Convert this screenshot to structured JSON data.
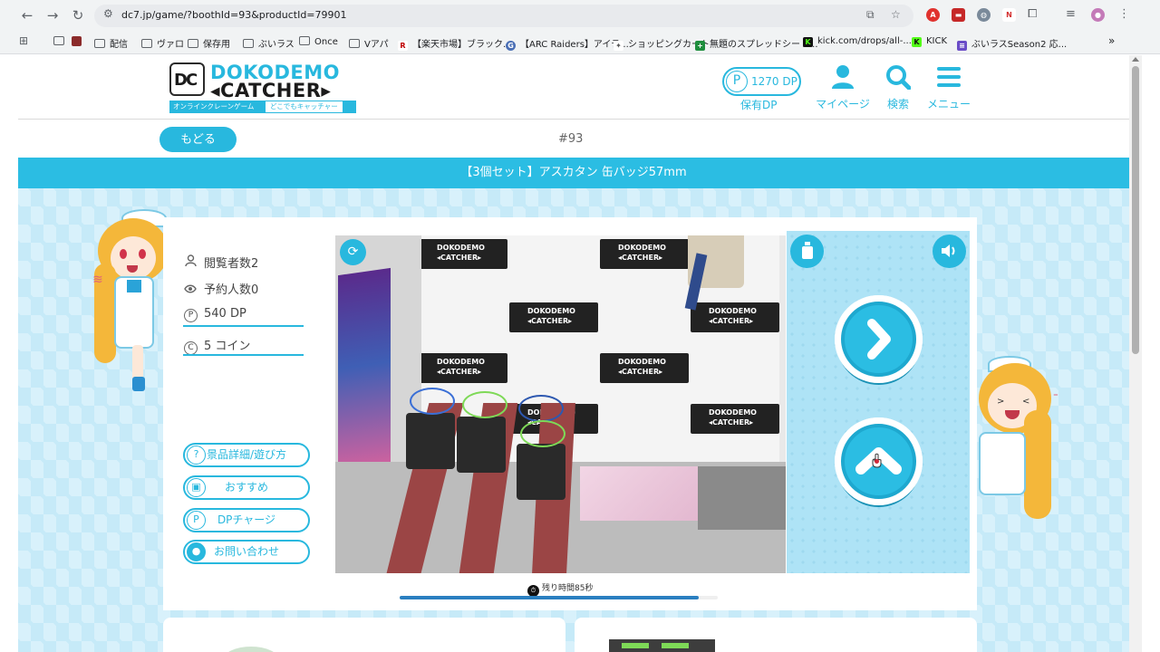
{
  "browser": {
    "url": "dc7.jp/game/?boothId=93&productId=79901",
    "bookmarks": [
      {
        "label": "",
        "kind": "folder"
      },
      {
        "label": "",
        "kind": "badge",
        "color": "#8b2b2b",
        "glyph": ""
      },
      {
        "label": "配信",
        "kind": "folder"
      },
      {
        "label": "ヴァロ",
        "kind": "folder"
      },
      {
        "label": "保存用",
        "kind": "folder"
      },
      {
        "label": "ぶいラス",
        "kind": "folder"
      },
      {
        "label": "Once",
        "kind": "folder"
      },
      {
        "label": "Vアパ",
        "kind": "folder"
      },
      {
        "label": "【楽天市場】ブラック...",
        "kind": "badge",
        "color": "#bf0000",
        "glyph": "R"
      },
      {
        "label": "【ARC Raiders】アイテ...",
        "kind": "badge",
        "color": "#4a6fb5",
        "glyph": "G"
      },
      {
        "label": "ショッピングカート",
        "kind": "badge",
        "color": "#555555",
        "glyph": "✦"
      },
      {
        "label": "無題のスプレッドシート...",
        "kind": "badge",
        "color": "#1e8e3e",
        "glyph": "+"
      },
      {
        "label": "kick.com/drops/all-...",
        "kind": "badge",
        "color": "#111111",
        "glyph": "K"
      },
      {
        "label": "KICK",
        "kind": "badge",
        "color": "#53fc18",
        "glyph": "K"
      },
      {
        "label": "ぶいラスSeason2 応...",
        "kind": "badge",
        "color": "#6a4cc7",
        "glyph": "≡"
      }
    ],
    "more_bookmarks": "»"
  },
  "header": {
    "logo_top": "DOKODEMO",
    "logo_bottom": "◂CATCHER▸",
    "logo_mark": "DC",
    "logo_sub_left": "オンラインクレーンゲーム",
    "logo_sub_right": "どこでもキャッチャー",
    "dp_symbol": "P",
    "dp_amount": "1270 DP",
    "dp_label": "保有DP",
    "mypage_label": "マイページ",
    "search_label": "検索",
    "menu_label": "メニュー"
  },
  "subheader": {
    "back_label": "もどる",
    "booth_number": "#93"
  },
  "product_title": "【3個セット】アスカタン 缶バッジ57mm",
  "stats": {
    "viewers": "閲覧者数2",
    "reservations": "予約人数0",
    "dp_cost": "540 DP",
    "coin_cost": "5 コイン"
  },
  "side_buttons": {
    "details": "景品詳細/遊び方",
    "recommended": "おすすめ",
    "dp_charge": "DPチャージ",
    "contact": "お問い合わせ"
  },
  "camera": {
    "tile_text_1": "DOKODEMO",
    "tile_text_2": "◂CATCHER▸"
  },
  "timer": {
    "label": "残り時間85秒",
    "remaining_fraction": 0.94
  },
  "colors": {
    "accent": "#28b8de",
    "title_bar": "#2bbde3",
    "timer_fill": "#2a7fc0"
  }
}
